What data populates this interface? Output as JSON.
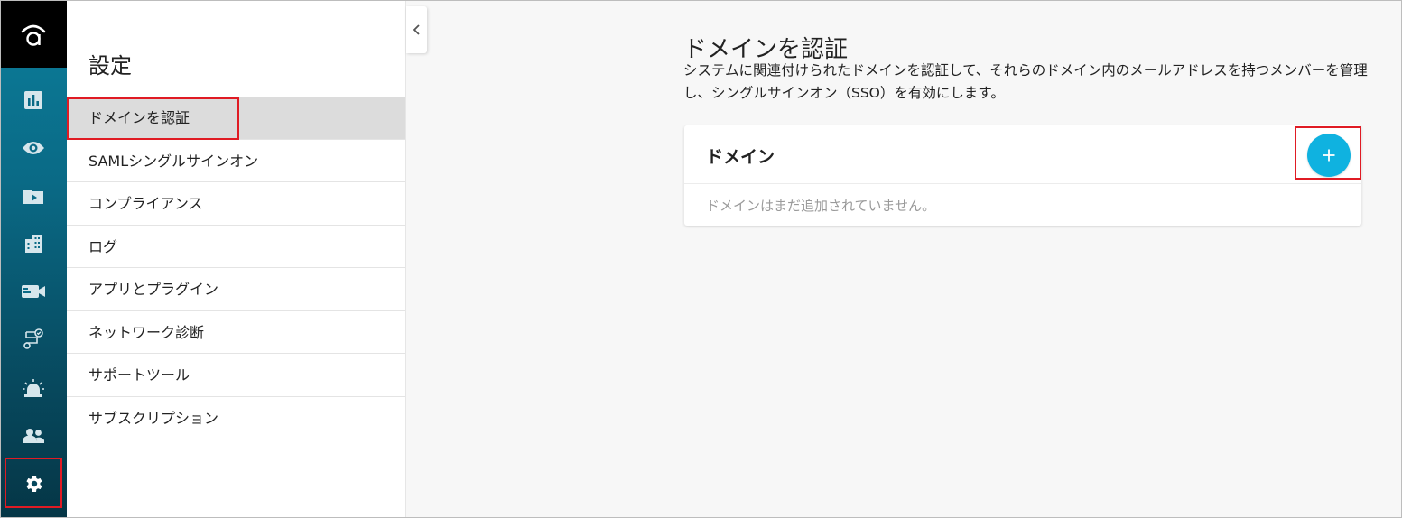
{
  "rail": {
    "logo": "a",
    "items": [
      {
        "icon": "analytics-icon"
      },
      {
        "icon": "eye-icon"
      },
      {
        "icon": "video-library-icon"
      },
      {
        "icon": "building-icon"
      },
      {
        "icon": "camera-icon"
      },
      {
        "icon": "workflow-icon"
      },
      {
        "icon": "alarm-icon"
      },
      {
        "icon": "people-icon"
      },
      {
        "icon": "gear-icon"
      }
    ]
  },
  "settings": {
    "title": "設定",
    "items": [
      {
        "label": "ドメインを認証",
        "active": true
      },
      {
        "label": "SAMLシングルサインオン"
      },
      {
        "label": "コンプライアンス"
      },
      {
        "label": "ログ"
      },
      {
        "label": "アプリとプラグイン"
      },
      {
        "label": "ネットワーク診断"
      },
      {
        "label": "サポートツール"
      },
      {
        "label": "サブスクリプション"
      }
    ]
  },
  "main": {
    "title": "ドメインを認証",
    "description": "システムに関連付けられたドメインを認証して、それらのドメイン内のメールアドレスを持つメンバーを管理し、シングルサインオン（SSO）を有効にします。",
    "card": {
      "title": "ドメイン",
      "add_label": "+",
      "empty_text": "ドメインはまだ追加されていません。"
    }
  },
  "colors": {
    "accent": "#0fb2e0",
    "highlight": "#e01b24",
    "rail_top": "#0c7e9b",
    "rail_bottom": "#053646"
  }
}
